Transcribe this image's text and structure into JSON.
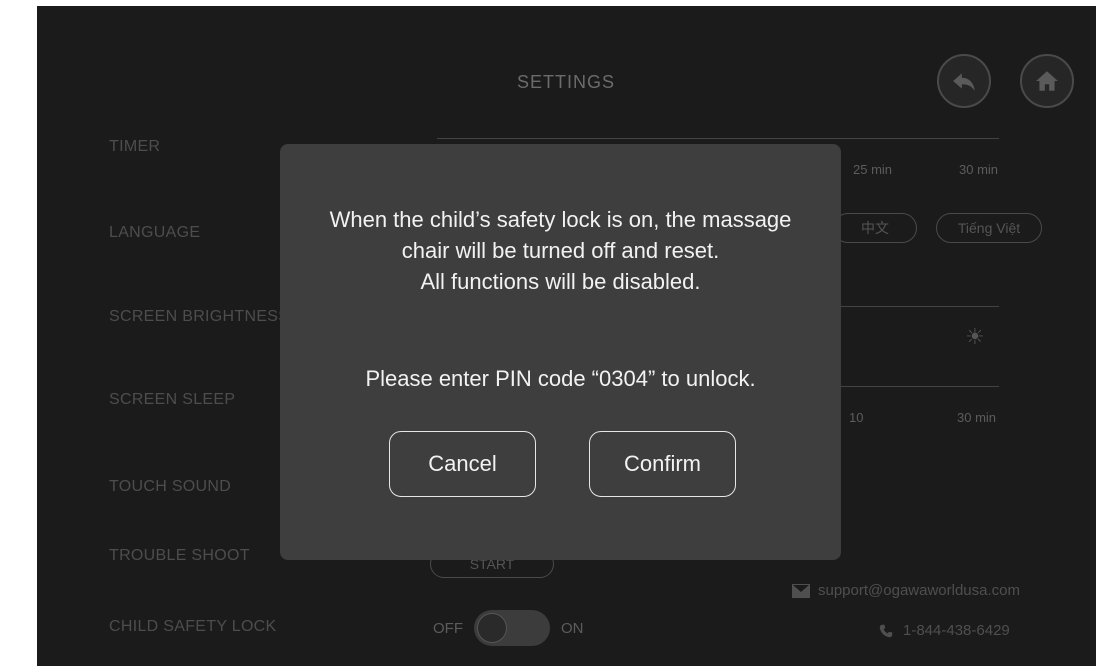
{
  "header": {
    "title": "SETTINGS",
    "back_icon": "back-arrow-icon",
    "home_icon": "home-icon"
  },
  "settings": {
    "timer": {
      "label": "TIMER",
      "ticks": [
        "25 min",
        "30 min"
      ]
    },
    "language": {
      "label": "LANGUAGE",
      "options": [
        "中文",
        "Tiếng Việt"
      ]
    },
    "screen_brightness": {
      "label": "SCREEN BRIGHTNESS"
    },
    "screen_sleep": {
      "label": "SCREEN SLEEP",
      "ticks": [
        "10",
        "30 min"
      ]
    },
    "touch_sound": {
      "label": "TOUCH SOUND"
    },
    "trouble_shoot": {
      "label": "TROUBLE SHOOT",
      "button": "START"
    },
    "child_safety_lock": {
      "label": "CHILD SAFETY LOCK",
      "off_label": "OFF",
      "on_label": "ON"
    }
  },
  "contact": {
    "email": "support@ogawaworldusa.com",
    "phone": "1-844-438-6429"
  },
  "modal": {
    "lines": [
      "When the child’s safety lock is on, the massage",
      "chair will be turned off and reset.",
      "All functions will be disabled."
    ],
    "pin_prompt": "Please enter PIN code “0304” to unlock.",
    "cancel_label": "Cancel",
    "confirm_label": "Confirm"
  }
}
